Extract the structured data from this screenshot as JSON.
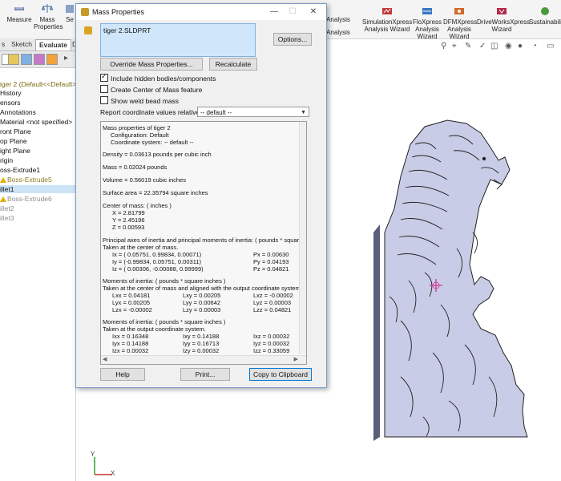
{
  "ribbon": {
    "measure": "Measure",
    "mass_properties_l1": "Mass",
    "mass_properties_l2": "Properties",
    "section_partial": "Se",
    "analysis_top": "Analysis",
    "analysis_bottom": "Analysis",
    "simulationxpress_l1": "SimulationXpress",
    "simulationxpress_l2": "Analysis Wizard",
    "floxpress_l1": "FloXpress",
    "floxpress_l2": "Analysis",
    "floxpress_l3": "Wizard",
    "dfmxpress_l1": "DFMXpress",
    "dfmxpress_l2": "Analysis",
    "dfmxpress_l3": "Wizard",
    "driveworks_l1": "DriveWorksXpress",
    "driveworks_l2": "Wizard",
    "sustainability": "Sustainabili"
  },
  "tabs": [
    "s",
    "Sketch",
    "Evaluate",
    "D"
  ],
  "tree": {
    "root": "iger 2  (Default<<Default>_D",
    "items": [
      "History",
      "ensors",
      "Annotations",
      "Material <not specified>",
      "ront Plane",
      "op Plane",
      "ight Plane",
      "rigin",
      "oss-Extrude1",
      "Boss-Extrude5",
      "illet1",
      "Boss-Extrude6",
      "illet2",
      "illet3"
    ]
  },
  "dialog": {
    "title": "Mass Properties",
    "part_file": "tiger 2.SLDPRT",
    "options_button": "Options...",
    "override_button": "Override Mass Properties...",
    "recalculate_button": "Recalculate",
    "include_hidden": "Include hidden bodies/components",
    "create_com": "Create Center of Mass feature",
    "show_weld": "Show weld bead mass",
    "report_label": "Report coordinate values relative to:",
    "coord_value": "-- default --",
    "help_button": "Help",
    "print_button": "Print...",
    "copy_button": "Copy to Clipboard",
    "results": {
      "l1": "Mass properties of tiger 2",
      "l2": "Configuration: Default",
      "l3": "Coordinate system: -- default --",
      "density": "Density = 0.03613 pounds per cubic inch",
      "mass": "Mass = 0.02024 pounds",
      "volume": "Volume = 0.56019 cubic inches",
      "surface": "Surface area = 22.35794 square inches",
      "com_title": "Center of mass: ( inches )",
      "com_x": "X = 2.81799",
      "com_y": "Y = 2.45196",
      "com_z": "Z = 0.00593",
      "pa_title": "Principal axes of inertia and principal moments of inertia: ( pounds * square",
      "pa_sub": "Taken at the center of mass.",
      "ix": "Ix = ( 0.05751,  0.99834,  0.00071)",
      "iy": "Iy = (-0.99834,  0.05751,  0.00311)",
      "iz": "Iz = ( 0.00306, -0.00088,  0.99999)",
      "px": "Px = 0.00630",
      "py": "Py = 0.04193",
      "pz": "Pz = 0.04821",
      "moi1_title": "Moments of inertia: ( pounds * square inches )",
      "moi1_sub": "Taken at the center of mass and aligned with the output coordinate system.",
      "m1": [
        [
          "Lxx = 0.04181",
          "Lxy = 0.00205",
          "Lxz = -0.00002"
        ],
        [
          "Lyx = 0.00205",
          "Lyy = 0.00642",
          "Lyz = 0.00003"
        ],
        [
          "Lzx = -0.00002",
          "Lzy = 0.00003",
          "Lzz = 0.04821"
        ]
      ],
      "moi2_title": "Moments of inertia: ( pounds * square inches )",
      "moi2_sub": "Taken at the output coordinate system.",
      "m2": [
        [
          "Ixx = 0.16348",
          "Ixy = 0.14188",
          "Ixz = 0.00032"
        ],
        [
          "Iyx = 0.14188",
          "Iyy = 0.16713",
          "Iyz = 0.00032"
        ],
        [
          "Izx = 0.00032",
          "Izy = 0.00032",
          "Izz = 0.33059"
        ]
      ]
    }
  },
  "axes": {
    "y": "Y",
    "x": "X"
  }
}
